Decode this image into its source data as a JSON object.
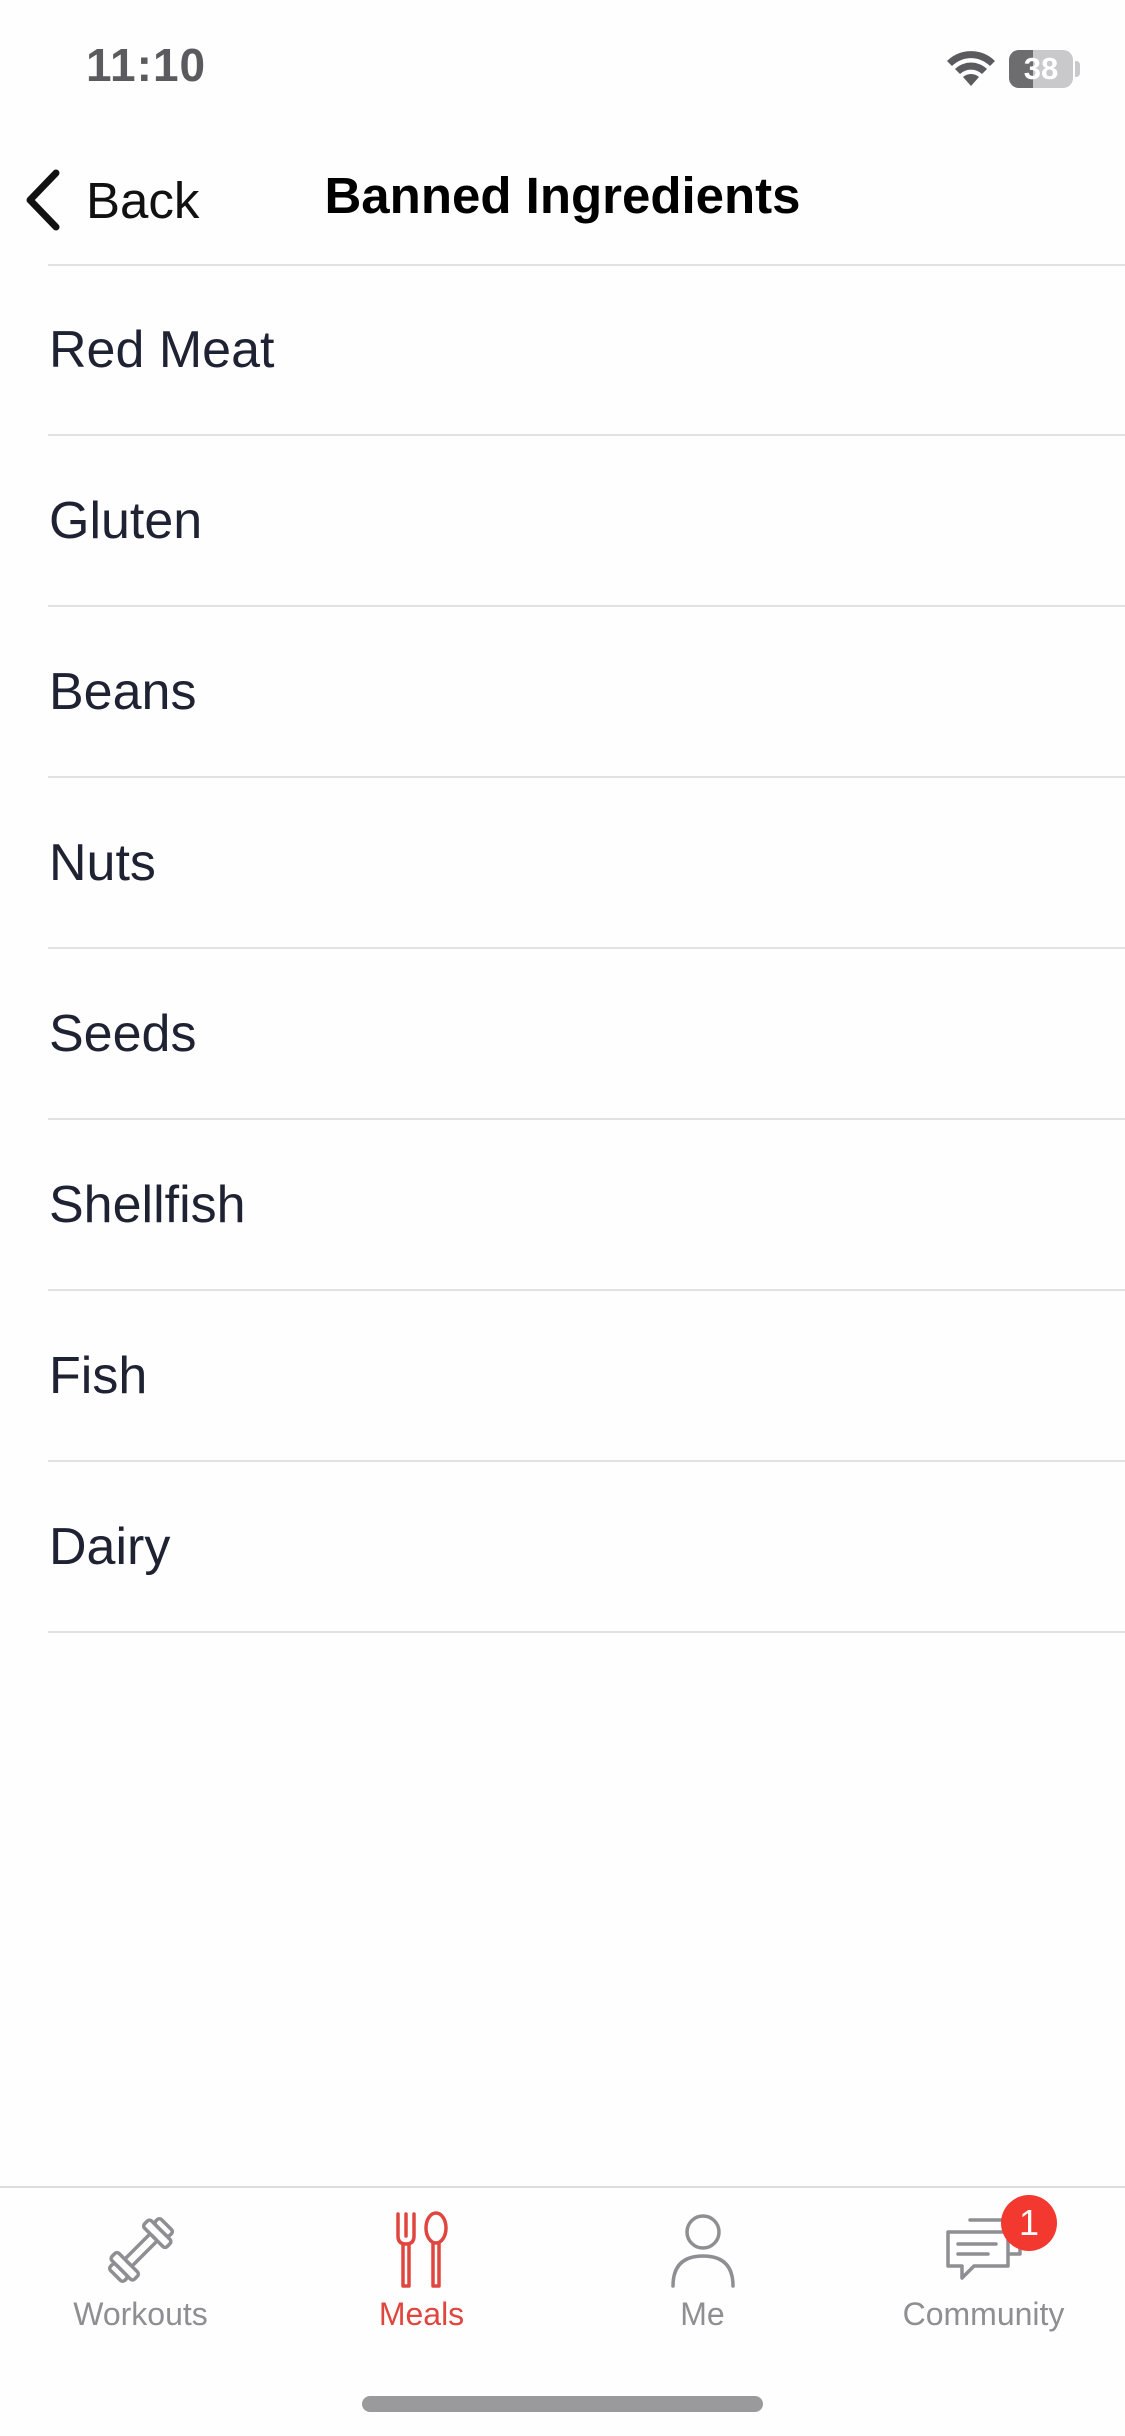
{
  "status_bar": {
    "time": "11:10",
    "battery_percent": "38",
    "battery_level": 0.38
  },
  "nav": {
    "back_label": "Back",
    "title": "Banned Ingredients"
  },
  "ingredients": [
    "Red Meat",
    "Gluten",
    "Beans",
    "Nuts",
    "Seeds",
    "Shellfish",
    "Fish",
    "Dairy"
  ],
  "tab_bar": {
    "tabs": [
      {
        "label": "Workouts",
        "icon": "dumbbell-icon",
        "active": false
      },
      {
        "label": "Meals",
        "icon": "fork-spoon-icon",
        "active": true
      },
      {
        "label": "Me",
        "icon": "person-icon",
        "active": false
      },
      {
        "label": "Community",
        "icon": "chat-bubbles-icon",
        "active": false
      }
    ],
    "community_badge": "1"
  },
  "colors": {
    "accent": "#e0463f",
    "inactive": "#8e8e93",
    "badge": "#f2382f",
    "text": "#1f2233"
  }
}
